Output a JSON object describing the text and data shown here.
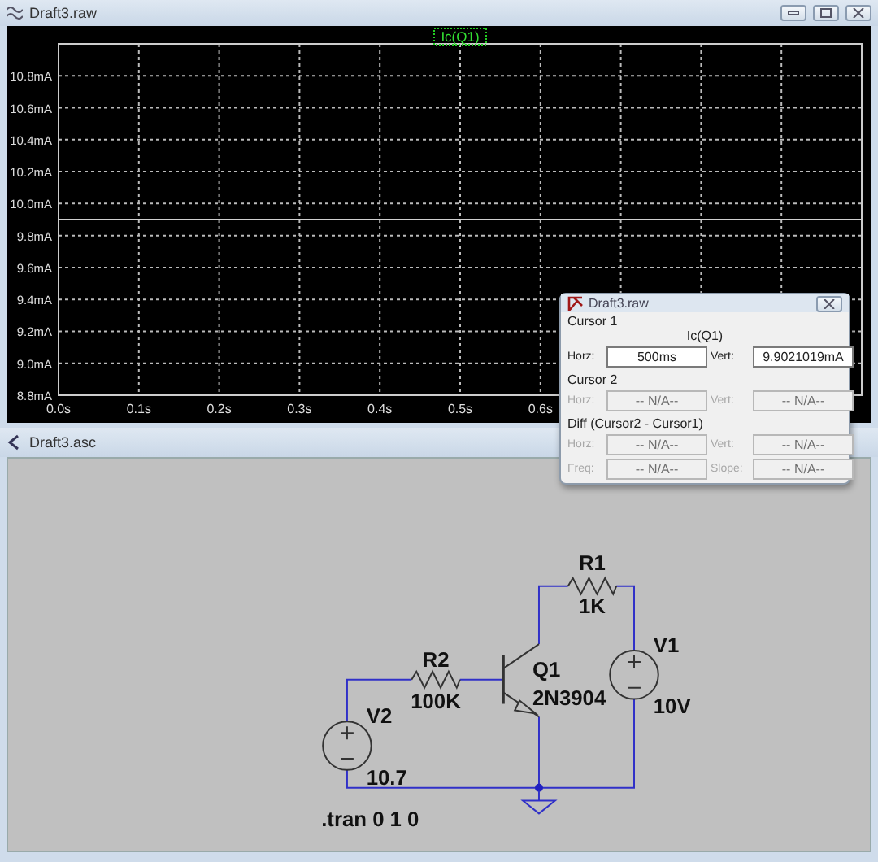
{
  "plot_window": {
    "title": "Draft3.raw",
    "chart_data": {
      "type": "line",
      "x": [
        0,
        1
      ],
      "series": [
        {
          "name": "Ic(Q1)",
          "color": "#d0d0d0",
          "values": [
            9.9,
            9.9
          ]
        }
      ],
      "xlim": [
        0,
        1
      ],
      "ylim": [
        8.8,
        11
      ],
      "grid": true,
      "xticks": [
        {
          "value": 0,
          "label": "0.0s"
        },
        {
          "value": 0.1,
          "label": "0.1s"
        },
        {
          "value": 0.2,
          "label": "0.2s"
        },
        {
          "value": 0.3,
          "label": "0.3s"
        },
        {
          "value": 0.4,
          "label": "0.4s"
        },
        {
          "value": 0.5,
          "label": "0.5s"
        },
        {
          "value": 0.6,
          "label": "0.6s"
        }
      ],
      "yticks": [
        {
          "value": 8.8,
          "label": "8.8mA"
        },
        {
          "value": 9.0,
          "label": "9.0mA"
        },
        {
          "value": 9.2,
          "label": "9.2mA"
        },
        {
          "value": 9.4,
          "label": "9.4mA"
        },
        {
          "value": 9.6,
          "label": "9.6mA"
        },
        {
          "value": 9.8,
          "label": "9.8mA"
        },
        {
          "value": 10.0,
          "label": "10.0mA"
        },
        {
          "value": 10.2,
          "label": "10.2mA"
        },
        {
          "value": 10.4,
          "label": "10.4mA"
        },
        {
          "value": 10.6,
          "label": "10.6mA"
        },
        {
          "value": 10.8,
          "label": "10.8mA"
        }
      ]
    }
  },
  "cursor_dialog": {
    "title": "Draft3.raw",
    "sections": [
      {
        "label": "Cursor 1",
        "trace": "Ic(Q1)",
        "fields": [
          {
            "label": "Horz:",
            "value": "500ms",
            "disabled": false
          },
          {
            "label": "Vert:",
            "value": "9.9021019mA",
            "disabled": false
          }
        ]
      },
      {
        "label": "Cursor 2",
        "fields": [
          {
            "label": "Horz:",
            "value": "-- N/A--",
            "disabled": true
          },
          {
            "label": "Vert:",
            "value": "-- N/A--",
            "disabled": true
          }
        ]
      },
      {
        "label": "Diff (Cursor2 - Cursor1)",
        "fields": [
          {
            "label": "Horz:",
            "value": "-- N/A--",
            "disabled": true
          },
          {
            "label": "Vert:",
            "value": "-- N/A--",
            "disabled": true
          },
          {
            "label": "Freq:",
            "value": "-- N/A--",
            "disabled": true
          },
          {
            "label": "Slope:",
            "value": "-- N/A--",
            "disabled": true
          }
        ]
      }
    ]
  },
  "schematic_window": {
    "title": "Draft3.asc",
    "components": [
      {
        "kind": "resistor",
        "name": "R1",
        "value": "1K"
      },
      {
        "kind": "resistor",
        "name": "R2",
        "value": "100K"
      },
      {
        "kind": "npn",
        "name": "Q1",
        "value": "2N3904"
      },
      {
        "kind": "source",
        "name": "V1",
        "value": "10V"
      },
      {
        "kind": "source",
        "name": "V2",
        "value": "10.7"
      }
    ],
    "directive": ".tran 0 1 0"
  }
}
